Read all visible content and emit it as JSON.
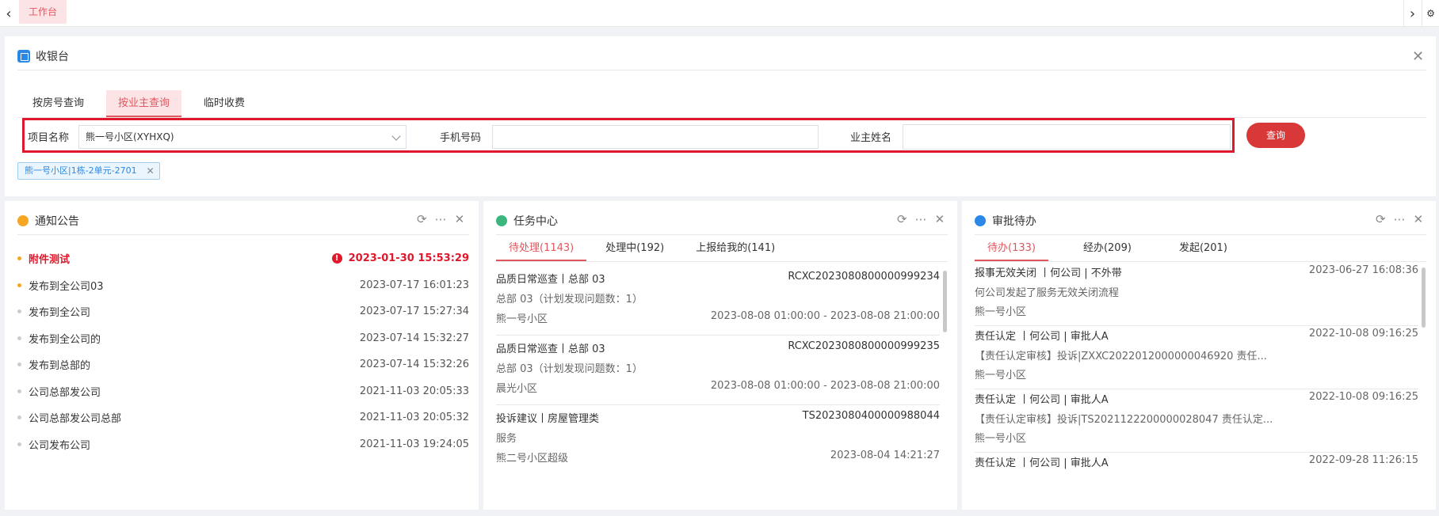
{
  "topbar": {
    "prev": "‹",
    "next": "›",
    "tab": "工作台"
  },
  "cashier": {
    "title": "收银台",
    "tabs": [
      "按房号查询",
      "按业主查询",
      "临时收费"
    ],
    "active_tab": 1,
    "project_label": "项目名称",
    "project_value": "熊一号小区(XYHXQ)",
    "phone_label": "手机号码",
    "phone_value": "",
    "owner_label": "业主姓名",
    "owner_value": "",
    "query_button": "查询",
    "selected_tag": "熊一号小区|1栋-2单元-2701"
  },
  "notice": {
    "title": "通知公告",
    "items": [
      {
        "text": "附件测试",
        "time": "2023-01-30 15:53:29",
        "urgent": true
      },
      {
        "text": "发布到全公司03",
        "time": "2023-07-17 16:01:23"
      },
      {
        "text": "发布到全公司",
        "time": "2023-07-17 15:27:34"
      },
      {
        "text": "发布到全公司的",
        "time": "2023-07-14 15:32:27"
      },
      {
        "text": "发布到总部的",
        "time": "2023-07-14 15:32:26"
      },
      {
        "text": "公司总部发公司",
        "time": "2021-11-03 20:05:33"
      },
      {
        "text": "公司总部发公司总部",
        "time": "2021-11-03 20:05:32"
      },
      {
        "text": "公司发布公司",
        "time": "2021-11-03 19:24:05"
      }
    ]
  },
  "task": {
    "title": "任务中心",
    "tabs": [
      "待处理(1143)",
      "处理中(192)",
      "上报给我的(141)"
    ],
    "items": [
      {
        "title": "品质日常巡查丨总部 03",
        "code": "RCXC2023080800000999234",
        "desc": "总部 03（计划发现问题数：1）",
        "place": "熊一号小区",
        "time": "2023-08-08 01:00:00 - 2023-08-08 21:00:00"
      },
      {
        "title": "品质日常巡查丨总部 03",
        "code": "RCXC2023080800000999235",
        "desc": "总部 03（计划发现问题数：1）",
        "place": "晨光小区",
        "time": "2023-08-08 01:00:00 - 2023-08-08 21:00:00"
      },
      {
        "title": "投诉建议丨房屋管理类",
        "code": "TS2023080400000988044",
        "desc": "服务",
        "place": "熊二号小区超级",
        "time": "2023-08-04 14:21:27"
      }
    ]
  },
  "approval": {
    "title": "审批待办",
    "tabs": [
      "待办(133)",
      "经办(209)",
      "发起(201)"
    ],
    "items": [
      {
        "title": "报事无效关闭 丨何公司 | 不外带",
        "time": "2023-06-27 16:08:36",
        "desc": "何公司发起了服务无效关闭流程",
        "place": "熊一号小区"
      },
      {
        "title": "责任认定 丨何公司 | 审批人A",
        "time": "2022-10-08 09:16:25",
        "desc": "【责任认定审核】投诉|ZXXC2022012000000046920 责任...",
        "place": "熊一号小区"
      },
      {
        "title": "责任认定 丨何公司 | 审批人A",
        "time": "2022-10-08 09:16:25",
        "desc": "【责任认定审核】投诉|TS2021122200000028047 责任认定...",
        "place": "熊一号小区"
      },
      {
        "title": "责任认定 丨何公司 | 审批人A",
        "time": "2022-09-28 11:26:15",
        "desc": "",
        "place": ""
      }
    ]
  },
  "icons": {
    "close": "close-icon",
    "refresh": "refresh-icon",
    "more": "more-icon"
  },
  "colors": {
    "accent": "#e0585f",
    "danger": "#e0182b",
    "primary": "#2c88e6",
    "button": "#d93838"
  }
}
